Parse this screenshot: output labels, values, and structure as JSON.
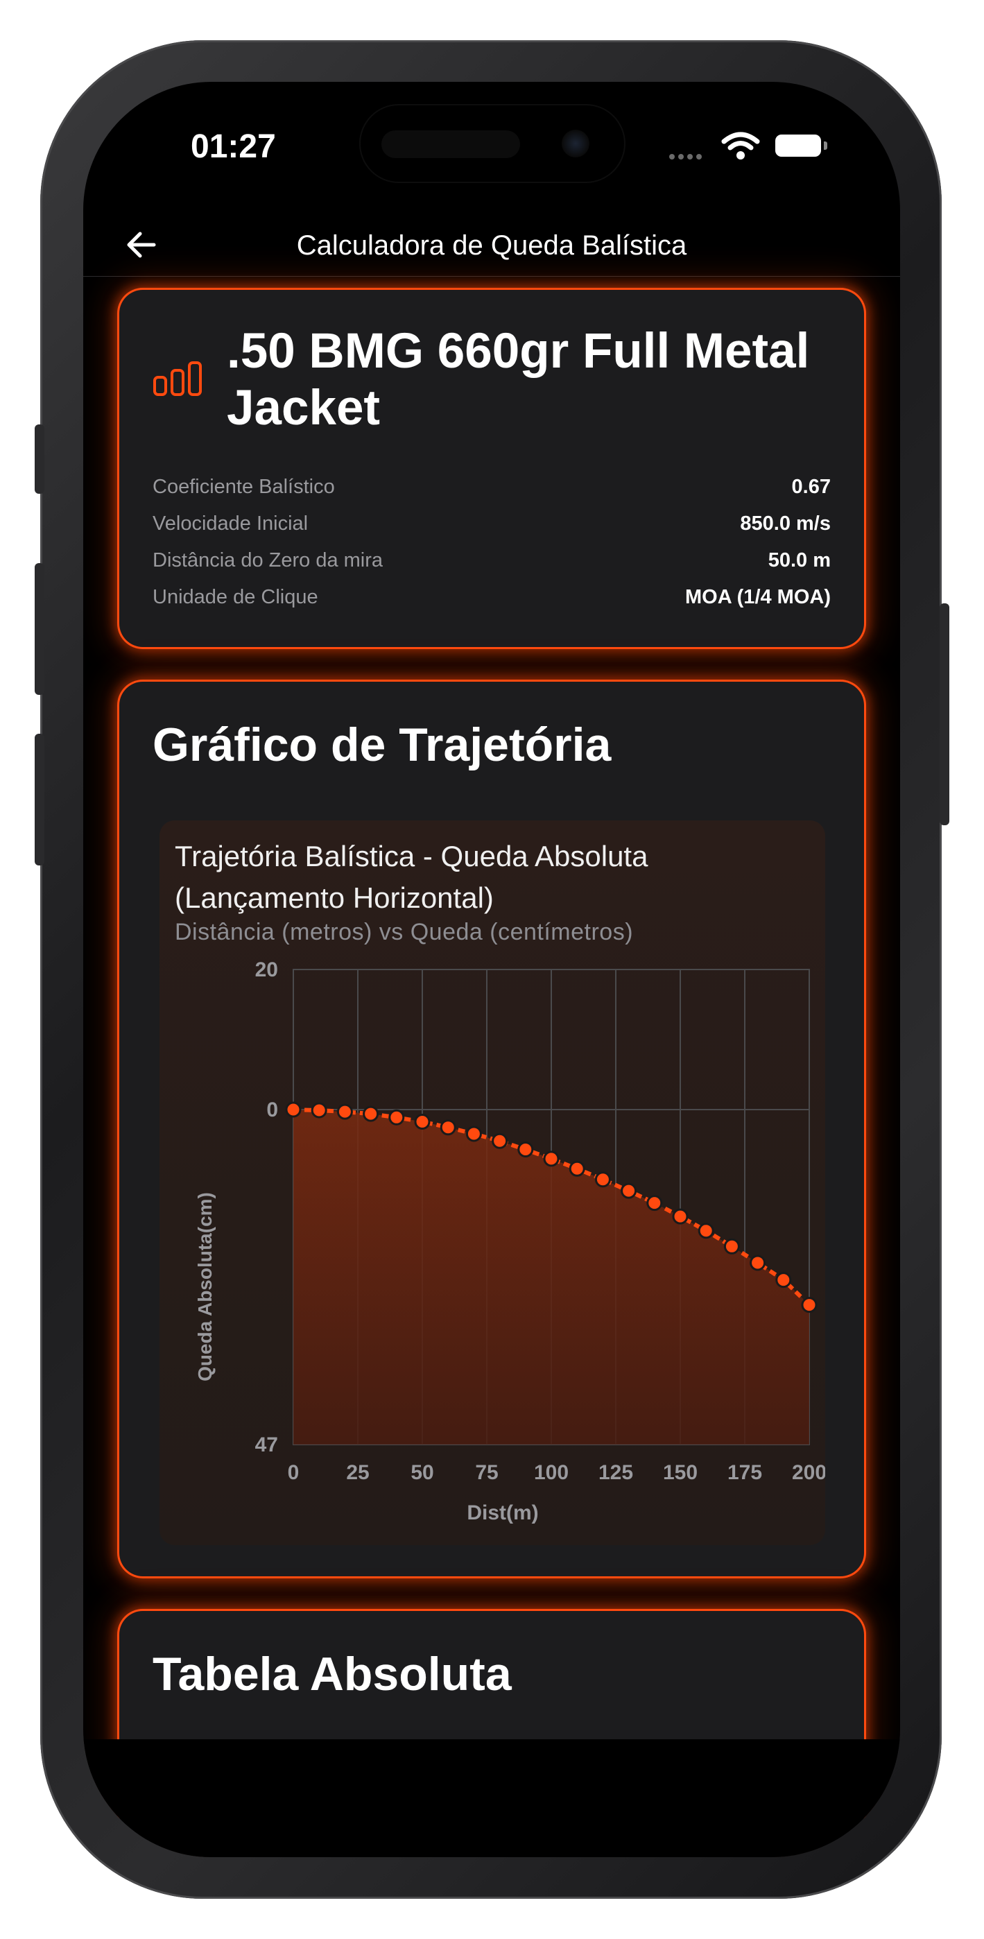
{
  "status_bar": {
    "time": "01:27"
  },
  "nav": {
    "title": "Calculadora de Queda Balística",
    "back_icon": "arrow-left-icon"
  },
  "ammo": {
    "icon": "bar-chart-icon",
    "title": ".50 BMG 660gr Full Metal Jacket",
    "specs": [
      {
        "label": "Coeficiente Balístico",
        "value": "0.67"
      },
      {
        "label": "Velocidade Inicial",
        "value": "850.0 m/s"
      },
      {
        "label": "Distância do Zero da mira",
        "value": "50.0 m"
      },
      {
        "label": "Unidade de Clique",
        "value": "MOA (1/4 MOA)"
      }
    ]
  },
  "trajectory": {
    "section_title": "Gráfico de Trajetória"
  },
  "chart_data": {
    "type": "area",
    "title": "Trajetória Balística - Queda Absoluta (Lançamento Horizontal)",
    "subtitle": "Distância (metros) vs Queda (centímetros)",
    "xlabel": "Dist(m)",
    "ylabel": "Queda Absoluta(cm)",
    "x_ticks": [
      "0",
      "25",
      "50",
      "75",
      "100",
      "125",
      "150",
      "175",
      "200"
    ],
    "y_ticks": [
      "20",
      "0",
      "47"
    ],
    "xlim": [
      0,
      200
    ],
    "ylim_top": 20,
    "ylim_bottom": -47,
    "y_axis_inverted_labels": true,
    "grid": true,
    "accent_color": "#ff4a0f",
    "x": [
      0,
      10,
      20,
      30,
      40,
      50,
      60,
      70,
      80,
      90,
      100,
      110,
      120,
      130,
      140,
      150,
      160,
      170,
      180,
      190,
      200
    ],
    "y": [
      0,
      -0.1,
      -0.3,
      -0.6,
      -1.1,
      -1.7,
      -2.5,
      -3.4,
      -4.4,
      -5.6,
      -6.9,
      -8.3,
      -9.8,
      -11.4,
      -13.1,
      -15.0,
      -17.0,
      -19.2,
      -21.5,
      -23.9,
      -27.4
    ]
  },
  "table": {
    "section_title": "Tabela Absoluta"
  }
}
